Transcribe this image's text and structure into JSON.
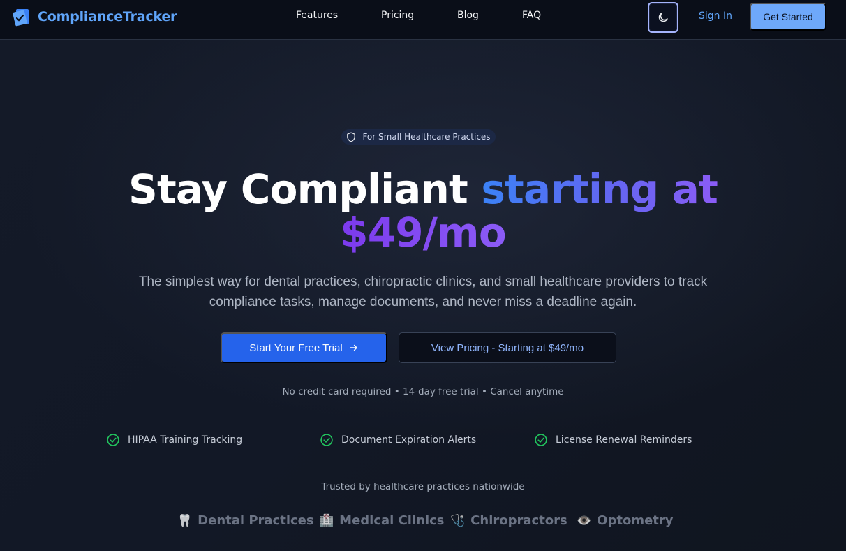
{
  "nav": {
    "brand": "ComplianceTracker",
    "links": [
      "Features",
      "Pricing",
      "Blog",
      "FAQ"
    ],
    "sign_in": "Sign In",
    "get_started": "Get Started"
  },
  "hero": {
    "badge": "For Small Healthcare Practices",
    "headline_white": "Stay Compliant",
    "headline_accent_1": "starting at",
    "headline_accent_2": "$49/mo",
    "subtitle": "The simplest way for dental practices, chiropractic clinics, and small healthcare providers to track compliance tasks, manage documents, and never miss a deadline again.",
    "primary_cta": "Start Your Free Trial",
    "secondary_cta": "View Pricing - Starting at $49/mo",
    "fineprint": "No credit card required • 14-day free trial • Cancel anytime"
  },
  "features": [
    "HIPAA Training Tracking",
    "Document Expiration Alerts",
    "License Renewal Reminders"
  ],
  "trusted": {
    "heading": "Trusted by healthcare practices nationwide",
    "items": [
      {
        "icon": "🦷",
        "label": "Dental Practices"
      },
      {
        "icon": "🏥",
        "label": "Medical Clinics"
      },
      {
        "icon": "🩺",
        "label": "Chiropractors"
      },
      {
        "icon": "👁️",
        "label": "Optometry"
      }
    ]
  },
  "colors": {
    "accent": "#60a5fa",
    "primary_button": "#2563eb",
    "check": "#22c55e"
  }
}
